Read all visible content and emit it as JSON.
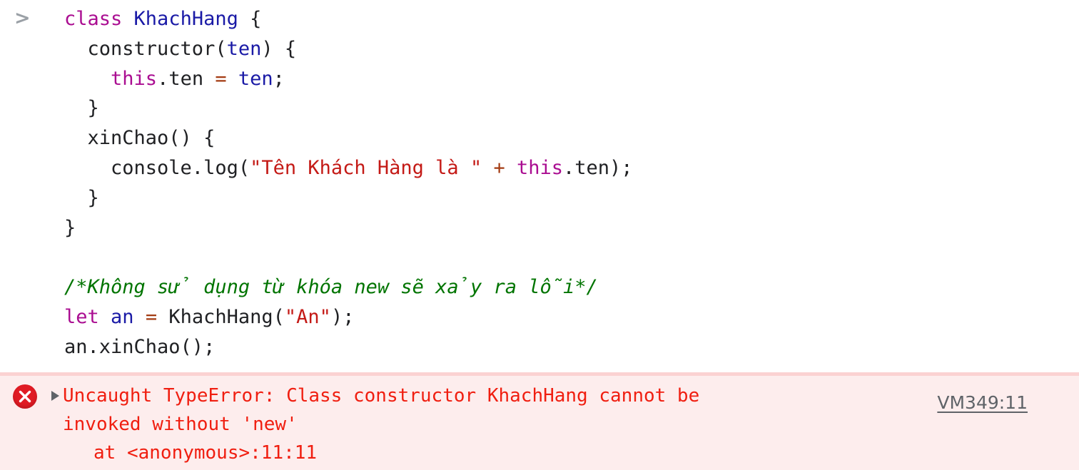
{
  "console": {
    "prompt_symbol": ">",
    "source_lines": [
      [
        {
          "t": "class ",
          "c": "tok-kw"
        },
        {
          "t": "KhachHang",
          "c": "tok-classname"
        },
        {
          "t": " {",
          "c": "tok-plain"
        }
      ],
      [
        {
          "t": "  constructor(",
          "c": "tok-plain"
        },
        {
          "t": "ten",
          "c": "tok-param"
        },
        {
          "t": ") {",
          "c": "tok-plain"
        }
      ],
      [
        {
          "t": "    ",
          "c": "tok-plain"
        },
        {
          "t": "this",
          "c": "tok-kw"
        },
        {
          "t": ".ten ",
          "c": "tok-plain"
        },
        {
          "t": "=",
          "c": "tok-op"
        },
        {
          "t": " ",
          "c": "tok-plain"
        },
        {
          "t": "ten",
          "c": "tok-param"
        },
        {
          "t": ";",
          "c": "tok-plain"
        }
      ],
      [
        {
          "t": "  }",
          "c": "tok-plain"
        }
      ],
      [
        {
          "t": "  xinChao() {",
          "c": "tok-plain"
        }
      ],
      [
        {
          "t": "    console.log(",
          "c": "tok-plain"
        },
        {
          "t": "\"Tên Khách Hàng là \"",
          "c": "tok-str"
        },
        {
          "t": " ",
          "c": "tok-plain"
        },
        {
          "t": "+",
          "c": "tok-op"
        },
        {
          "t": " ",
          "c": "tok-plain"
        },
        {
          "t": "this",
          "c": "tok-kw"
        },
        {
          "t": ".ten);",
          "c": "tok-plain"
        }
      ],
      [
        {
          "t": "  }",
          "c": "tok-plain"
        }
      ],
      [
        {
          "t": "}",
          "c": "tok-plain"
        }
      ],
      [],
      [
        {
          "t": "/*Không sử dụng từ khóa new sẽ xảy ra lỗi*/",
          "c": "tok-comment"
        }
      ],
      [
        {
          "t": "let",
          "c": "tok-kw"
        },
        {
          "t": " ",
          "c": "tok-plain"
        },
        {
          "t": "an",
          "c": "tok-param"
        },
        {
          "t": " ",
          "c": "tok-plain"
        },
        {
          "t": "=",
          "c": "tok-op"
        },
        {
          "t": " KhachHang(",
          "c": "tok-plain"
        },
        {
          "t": "\"An\"",
          "c": "tok-str"
        },
        {
          "t": ");",
          "c": "tok-plain"
        }
      ],
      [
        {
          "t": "an.xinChao();",
          "c": "tok-plain"
        }
      ]
    ],
    "error": {
      "icon_name": "error-circle-x-icon",
      "disclosure_state": "collapsed",
      "message_line_1": "Uncaught TypeError: Class constructor KhachHang cannot be",
      "message_line_2": "invoked without 'new'",
      "stack_line_1": "at <anonymous>:11:11",
      "source_link": "VM349:11",
      "colors": {
        "text": "#f01e10",
        "background": "#fdeded",
        "border": "#fbd2d2",
        "icon": "#e01b24",
        "link": "#5f6368"
      }
    },
    "syntax_colors": {
      "keyword": "#aa0d91",
      "class_name": "#1a1aa6",
      "parameter": "#1a1aa6",
      "operator": "#a33b12",
      "string": "#c41a16",
      "comment": "#007400",
      "plain": "#202124"
    }
  }
}
